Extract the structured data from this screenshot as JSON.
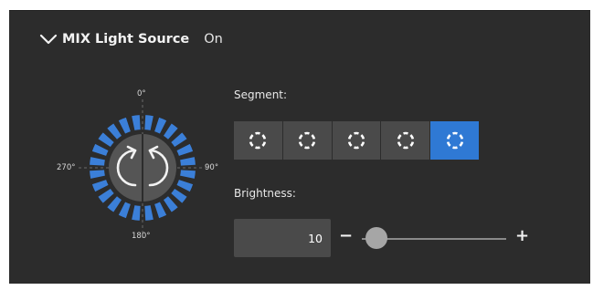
{
  "header": {
    "title": "MIX Light Source",
    "status": "On",
    "icon": "chevron-down-icon"
  },
  "dial": {
    "labels": {
      "top": "0°",
      "right": "90°",
      "bottom": "180°",
      "left": "270°"
    },
    "accent": "#3b7fd8",
    "icons": [
      "rotate-ccw-icon",
      "rotate-cw-icon"
    ]
  },
  "segment": {
    "label": "Segment:",
    "count": 5,
    "selected_index": 4,
    "icon": "ring-segment-icon",
    "active_color": "#2f79d4"
  },
  "brightness": {
    "label": "Brightness:",
    "value": "10",
    "minus": "−",
    "plus": "+",
    "slider_fraction": 0.1
  }
}
